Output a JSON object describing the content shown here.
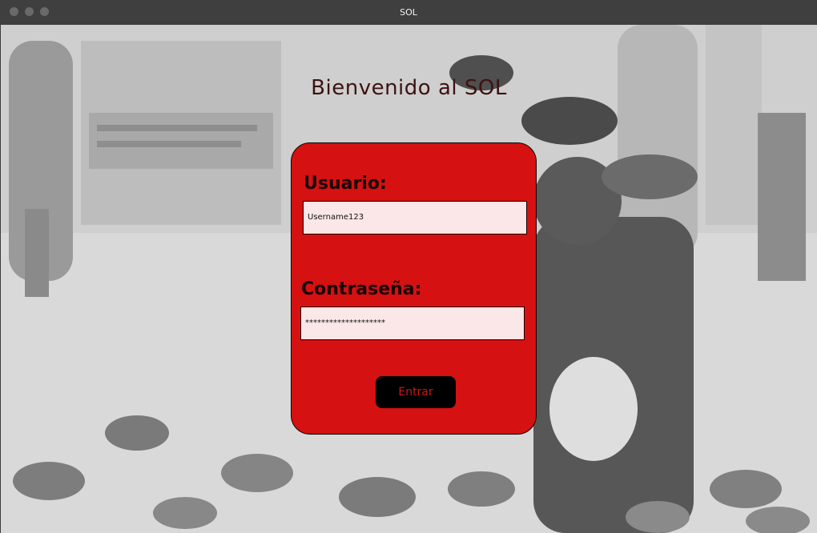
{
  "window": {
    "title": "SOL"
  },
  "page": {
    "heading": "Bienvenido al SOL"
  },
  "login": {
    "username_label": "Usuario:",
    "username_value": "Username123",
    "password_label": "Contraseña:",
    "password_value": "********************",
    "submit_label": "Entrar"
  },
  "colors": {
    "card": "#d51111",
    "input_bg": "#fbe7e7",
    "button_bg": "#000000",
    "button_text": "#c81818",
    "heading_text": "#3e1212"
  }
}
